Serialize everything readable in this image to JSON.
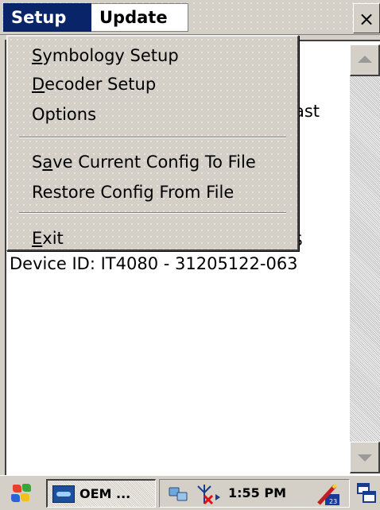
{
  "menubar": {
    "setup_label": "Setup",
    "update_label": "Update",
    "close_label": "×"
  },
  "content": {
    "partial_line_1": "ast",
    "partial_line_2": "9 $",
    "device_line": "Device ID: IT4080 - 31205122-063"
  },
  "setup_menu": {
    "items": [
      {
        "label_hotkey": "S",
        "label_rest": "ymbology Setup"
      },
      {
        "label_hotkey": "D",
        "label_rest": "ecoder Setup"
      },
      {
        "label": "Options"
      },
      {
        "label_pre": "S",
        "label_hotkey": "a",
        "label_rest": "ve Current Config To File"
      },
      {
        "label": "Restore Config From File"
      },
      {
        "label_hotkey": "E",
        "label_rest": "xit"
      }
    ]
  },
  "taskbar": {
    "app_button_label": "OEM ...",
    "clock": "1:55 PM",
    "input_panel_badge": "23"
  },
  "colors": {
    "menu_highlight": "#0a246a",
    "chrome": "#d4d0c8"
  }
}
